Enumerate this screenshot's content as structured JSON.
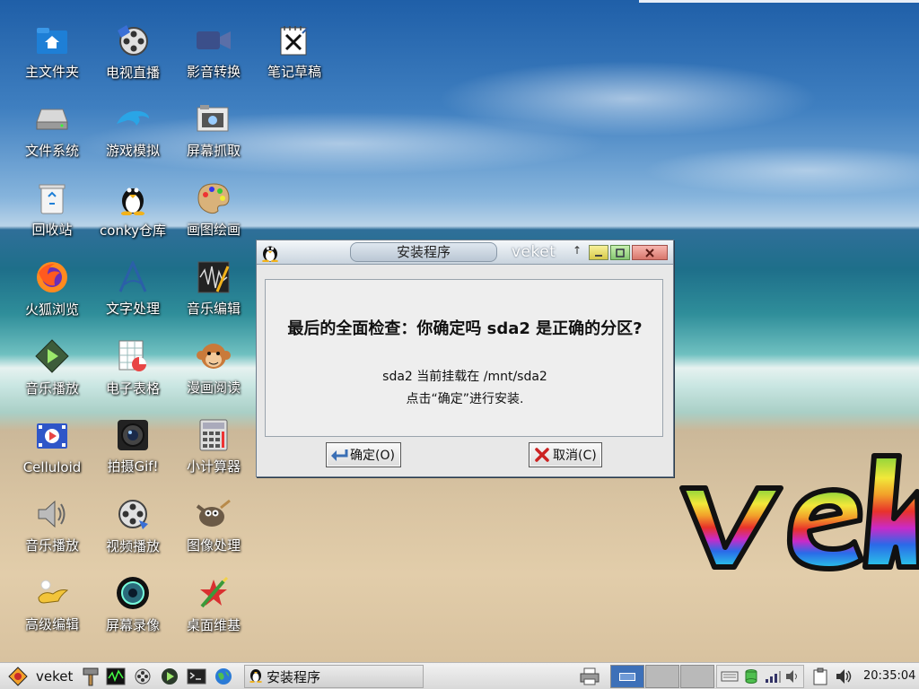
{
  "desktop": {
    "icons": [
      {
        "label": "主文件夹",
        "icon": "home-folder-icon"
      },
      {
        "label": "电视直播",
        "icon": "film-reel-icon"
      },
      {
        "label": "影音转换",
        "icon": "video-camera-icon"
      },
      {
        "label": "笔记草稿",
        "icon": "notepad-icon"
      },
      {
        "label": "文件系统",
        "icon": "hard-drive-icon"
      },
      {
        "label": "游戏模拟",
        "icon": "dolphin-icon"
      },
      {
        "label": "屏幕抓取",
        "icon": "screenshot-camera-icon"
      },
      {
        "label": "回收站",
        "icon": "trash-icon"
      },
      {
        "label": "conky仓库",
        "icon": "tux-icon"
      },
      {
        "label": "画图绘画",
        "icon": "paint-palette-icon"
      },
      {
        "label": "火狐浏览",
        "icon": "firefox-icon"
      },
      {
        "label": "文字处理",
        "icon": "abiword-icon"
      },
      {
        "label": "音乐编辑",
        "icon": "audio-editor-icon"
      },
      {
        "label": "音乐播放",
        "icon": "media-play-icon"
      },
      {
        "label": "电子表格",
        "icon": "spreadsheet-icon"
      },
      {
        "label": "漫画阅读",
        "icon": "monkey-icon"
      },
      {
        "label": "Celluloid",
        "icon": "celluloid-icon"
      },
      {
        "label": "拍摄Gif!",
        "icon": "camera-lens-icon"
      },
      {
        "label": "小计算器",
        "icon": "calculator-icon"
      },
      {
        "label": "音乐播放",
        "icon": "speaker-icon"
      },
      {
        "label": "视频播放",
        "icon": "video-reel-icon"
      },
      {
        "label": "图像处理",
        "icon": "gimp-icon"
      },
      {
        "label": "高级编辑",
        "icon": "genie-lamp-icon"
      },
      {
        "label": "屏幕录像",
        "icon": "recording-lens-icon"
      },
      {
        "label": "桌面维基",
        "icon": "wiki-pen-icon"
      }
    ]
  },
  "dialog": {
    "title": "安装程序",
    "brand": "veket",
    "question": "最后的全面检查：你确定吗 sda2 是正确的分区?",
    "info_line1": "sda2 当前挂载在  /mnt/sda2",
    "info_line2": "点击“确定”进行安装.",
    "ok_label": "确定(O)",
    "cancel_label": "取消(C)"
  },
  "taskbar": {
    "start_label": "veket",
    "task_title": "安装程序",
    "clock": "20:35:04"
  },
  "colors": {
    "pager_active": "#3d70b8",
    "ok_icon": "#3a6fb5",
    "cancel_icon": "#cc2222"
  }
}
